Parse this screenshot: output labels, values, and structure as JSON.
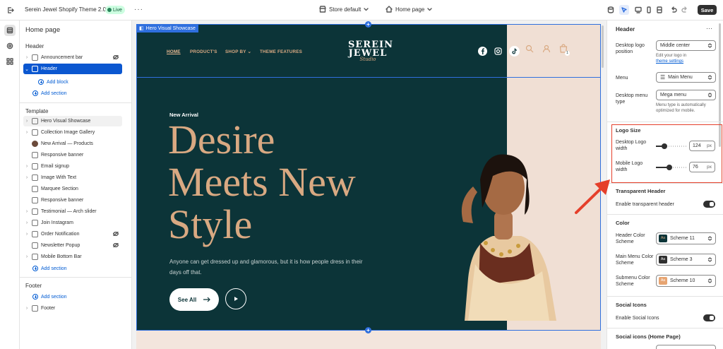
{
  "topbar": {
    "title": "Serein Jewel Shopify Theme 2.0",
    "live_label": "Live",
    "more_label": "···",
    "store_label": "Store default",
    "page_label": "Home page",
    "save_label": "Save"
  },
  "sidebar": {
    "page_title": "Home page",
    "header_section": "Header",
    "header_items": [
      {
        "label": "Announcement bar"
      },
      {
        "label": "Header"
      }
    ],
    "add_block": "Add block",
    "add_section": "Add section",
    "template_section": "Template",
    "template_items": [
      {
        "label": "Hero Visual Showcase"
      },
      {
        "label": "Collection Image Gallery"
      },
      {
        "label": "New Arrival — Products"
      },
      {
        "label": "Responsive banner"
      },
      {
        "label": "Email signup"
      },
      {
        "label": "Image With Text"
      },
      {
        "label": "Marquee Section"
      },
      {
        "label": "Responsive banner"
      },
      {
        "label": "Testimonial — Arch slider"
      },
      {
        "label": "Join Instagram"
      },
      {
        "label": "Order Notification"
      },
      {
        "label": "Newsletter Popup"
      },
      {
        "label": "Mobile Bottom Bar"
      }
    ],
    "footer_section": "Footer",
    "footer_items": [
      {
        "label": "Footer"
      }
    ]
  },
  "preview": {
    "section_badge": "Hero Visual Showcase",
    "nav": [
      "HOME",
      "PRODUCT'S",
      "SHOP BY",
      "THEME FEATURES"
    ],
    "logo_line1": "SEREIN",
    "logo_line2": "JEWEL",
    "logo_line3": "Studio",
    "cart_count": "1",
    "eyebrow": "New Arrival",
    "heading_line1": "Desire",
    "heading_line2": "Meets New",
    "heading_line3": "Style",
    "subtext": "Anyone can get dressed up and glamorous, but it is how people dress in their days off that.",
    "cta_label": "See All",
    "colors": {
      "dark": "#0c3438",
      "gold": "#d9a982",
      "peach": "#f0dfd4"
    }
  },
  "panel": {
    "title": "Header",
    "desktop_logo_position_label": "Desktop logo position",
    "desktop_logo_position_value": "Middle center",
    "logo_hint_prefix": "Edit your logo in",
    "logo_hint_link": "theme settings",
    "menu_label": "Menu",
    "menu_value": "Main Menu",
    "desktop_menu_type_label": "Desktop menu type",
    "desktop_menu_type_value": "Mega menu",
    "menu_type_hint": "Menu type is automatically optimized for mobile.",
    "logo_size_title": "Logo Size",
    "desktop_logo_width_label": "Desktop Logo width",
    "desktop_logo_width_value": "124",
    "mobile_logo_width_label": "Mobile Logo width",
    "mobile_logo_width_value": "76",
    "unit": "px",
    "transparent_header_title": "Transparent Header",
    "enable_transparent_label": "Enable transparent header",
    "color_title": "Color",
    "header_color_scheme_label": "Header Color Scheme",
    "header_color_scheme_value": "Scheme 11",
    "main_menu_color_scheme_label": "Main Menu Color Scheme",
    "main_menu_color_scheme_value": "Scheme 3",
    "submenu_color_scheme_label": "Submenu Color Scheme",
    "submenu_color_scheme_value": "Scheme 10",
    "social_icons_title": "Social Icons",
    "enable_social_label": "Enable Social Icons",
    "social_icons_home_title": "Social icons (Home Page)",
    "swatch_label": "Aa",
    "desktop_logo_slider_fraction": 0.28,
    "mobile_logo_slider_fraction": 0.45,
    "highlight_color": "#e53f2a"
  }
}
